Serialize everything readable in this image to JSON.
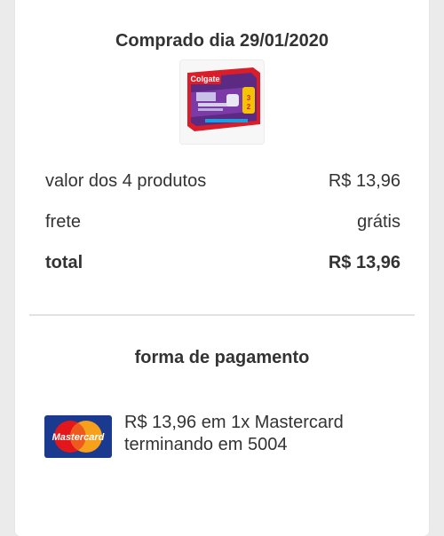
{
  "purchase": {
    "date_label": "Comprado dia 29/01/2020",
    "product_image": "colgate-toothpaste-pack"
  },
  "summary": {
    "items_label": "valor dos 4 produtos",
    "items_value": "R$ 13,96",
    "shipping_label": "frete",
    "shipping_value": "grátis",
    "total_label": "total",
    "total_value": "R$ 13,96"
  },
  "payment": {
    "title": "forma de pagamento",
    "description_line1": "R$ 13,96 em 1x Mastercard",
    "description_line2": "terminando em 5004",
    "card_brand": "Mastercard",
    "card_logo_colors": {
      "background": "#1a3a8f",
      "red": "#e3161b",
      "yellow": "#f7a01c"
    }
  },
  "product_colors": {
    "box_red": "#d91e2a",
    "box_purple": "#5b2a82"
  }
}
